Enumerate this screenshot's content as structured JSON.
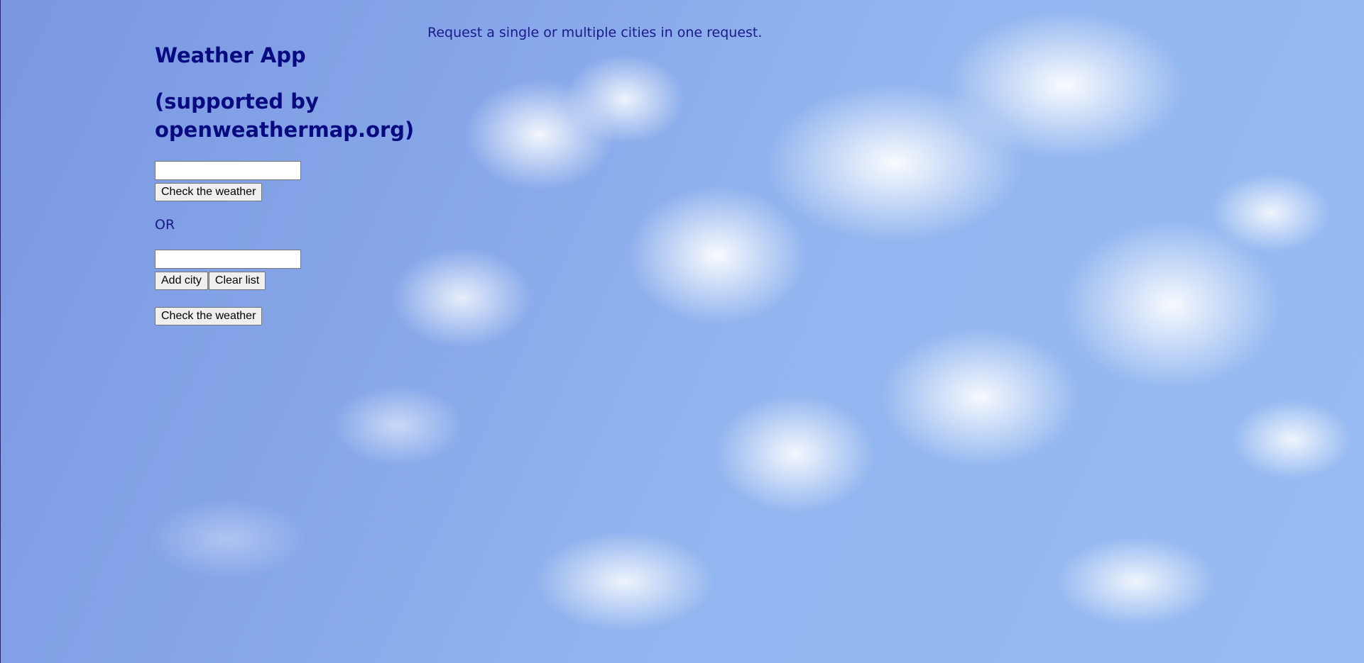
{
  "page": {
    "tagline": "Request a single or multiple cities in one request.",
    "title": "Weather App",
    "subtitle": "(supported by openweathermap.org)"
  },
  "single": {
    "city_input_value": "",
    "check_button_label": "Check the weather"
  },
  "separator_label": "OR",
  "multiple": {
    "city_input_value": "",
    "add_button_label": "Add city",
    "clear_button_label": "Clear list",
    "check_button_label": "Check the weather"
  },
  "colors": {
    "heading": "#0a0a80",
    "text": "#1a1a8a",
    "sky": "#8fb0e8"
  }
}
